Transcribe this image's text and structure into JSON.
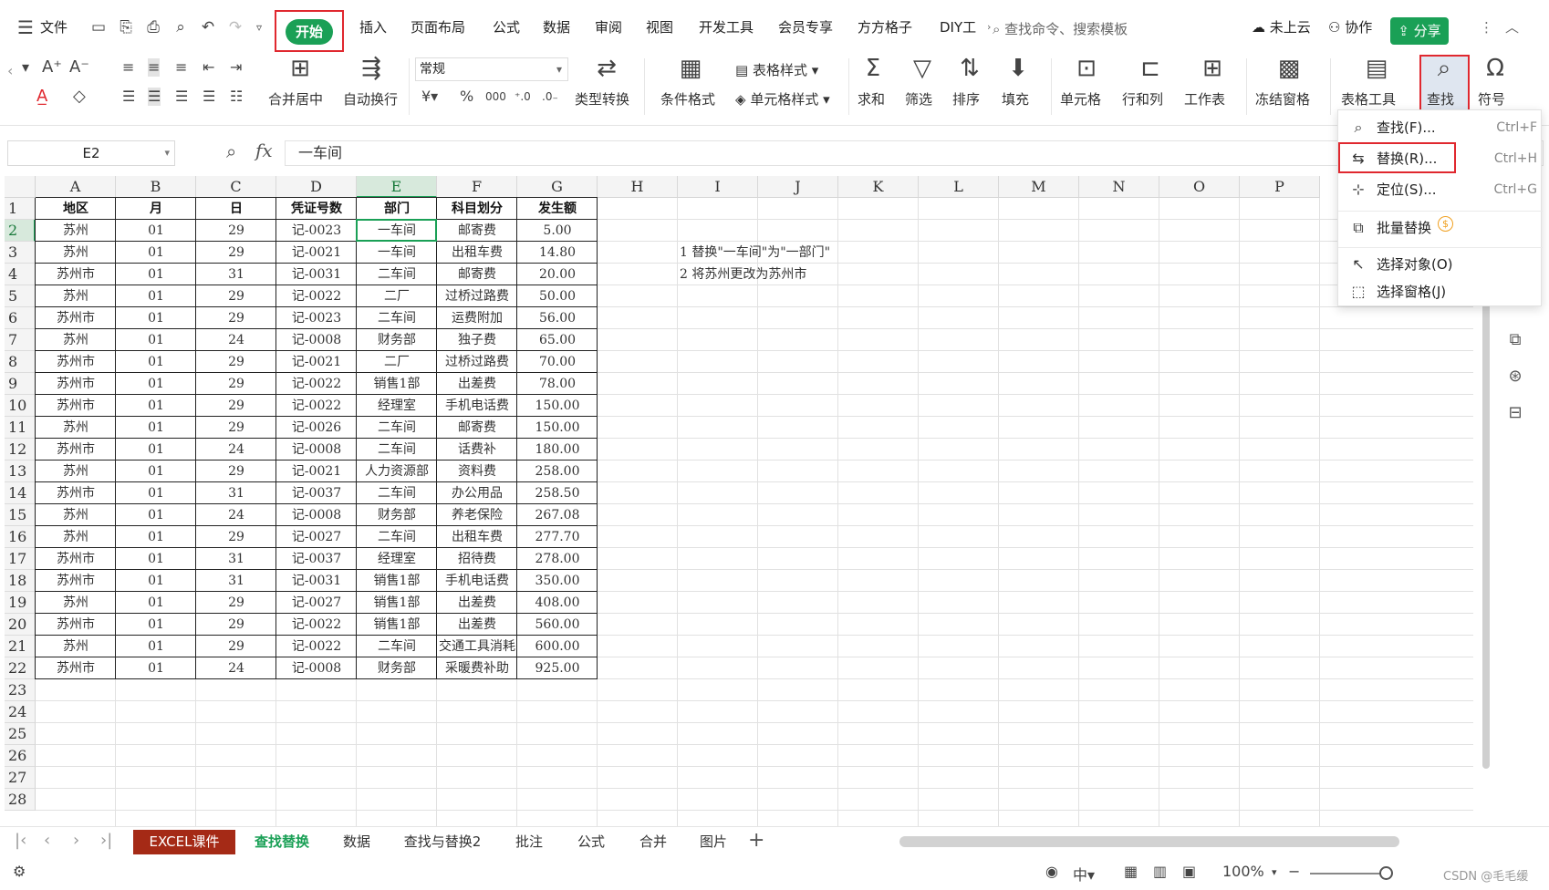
{
  "menubar": {
    "file": "文件",
    "tabs": [
      "开始",
      "插入",
      "页面布局",
      "公式",
      "数据",
      "审阅",
      "视图",
      "开发工具",
      "会员专享",
      "方方格子",
      "DIY工"
    ],
    "search_placeholder": "查找命令、搜索模板",
    "cloud": "未上云",
    "collab": "协作",
    "share": "分享"
  },
  "ribbon": {
    "merge_center": "合并居中",
    "wrap_text": "自动换行",
    "number_format": "常规",
    "type_convert": "类型转换",
    "cond_format": "条件格式",
    "table_style": "表格样式",
    "cell_style": "单元格样式",
    "sum": "求和",
    "filter": "筛选",
    "sort": "排序",
    "fill": "填充",
    "cell": "单元格",
    "row_col": "行和列",
    "worksheet": "工作表",
    "freeze": "冻结窗格",
    "table_tools": "表格工具",
    "find": "查找",
    "symbol": "符号"
  },
  "formula_bar": {
    "name_box": "E2",
    "fx": "fx",
    "content": "一车间"
  },
  "columns": [
    "A",
    "B",
    "C",
    "D",
    "E",
    "F",
    "G",
    "H",
    "I",
    "J",
    "K",
    "L",
    "M",
    "N",
    "O",
    "P"
  ],
  "rows": [
    "1",
    "2",
    "3",
    "4",
    "5",
    "6",
    "7",
    "8",
    "9",
    "10",
    "11",
    "12",
    "13",
    "14",
    "15",
    "16",
    "17",
    "18",
    "19",
    "20",
    "21",
    "22",
    "23",
    "24",
    "25",
    "26",
    "27",
    "28"
  ],
  "table": {
    "header": [
      "地区",
      "月",
      "日",
      "凭证号数",
      "部门",
      "科目划分",
      "发生额"
    ],
    "body": [
      [
        "苏州",
        "01",
        "29",
        "记-0023",
        "一车间",
        "邮寄费",
        "5.00"
      ],
      [
        "苏州",
        "01",
        "29",
        "记-0021",
        "一车间",
        "出租车费",
        "14.80"
      ],
      [
        "苏州市",
        "01",
        "31",
        "记-0031",
        "二车间",
        "邮寄费",
        "20.00"
      ],
      [
        "苏州",
        "01",
        "29",
        "记-0022",
        "二厂",
        "过桥过路费",
        "50.00"
      ],
      [
        "苏州市",
        "01",
        "29",
        "记-0023",
        "二车间",
        "运费附加",
        "56.00"
      ],
      [
        "苏州",
        "01",
        "24",
        "记-0008",
        "财务部",
        "独子费",
        "65.00"
      ],
      [
        "苏州市",
        "01",
        "29",
        "记-0021",
        "二厂",
        "过桥过路费",
        "70.00"
      ],
      [
        "苏州市",
        "01",
        "29",
        "记-0022",
        "销售1部",
        "出差费",
        "78.00"
      ],
      [
        "苏州市",
        "01",
        "29",
        "记-0022",
        "经理室",
        "手机电话费",
        "150.00"
      ],
      [
        "苏州",
        "01",
        "29",
        "记-0026",
        "二车间",
        "邮寄费",
        "150.00"
      ],
      [
        "苏州市",
        "01",
        "24",
        "记-0008",
        "二车间",
        "话费补",
        "180.00"
      ],
      [
        "苏州",
        "01",
        "29",
        "记-0021",
        "人力资源部",
        "资料费",
        "258.00"
      ],
      [
        "苏州市",
        "01",
        "31",
        "记-0037",
        "二车间",
        "办公用品",
        "258.50"
      ],
      [
        "苏州",
        "01",
        "24",
        "记-0008",
        "财务部",
        "养老保险",
        "267.08"
      ],
      [
        "苏州",
        "01",
        "29",
        "记-0027",
        "二车间",
        "出租车费",
        "277.70"
      ],
      [
        "苏州市",
        "01",
        "31",
        "记-0037",
        "经理室",
        "招待费",
        "278.00"
      ],
      [
        "苏州市",
        "01",
        "31",
        "记-0031",
        "销售1部",
        "手机电话费",
        "350.00"
      ],
      [
        "苏州",
        "01",
        "29",
        "记-0027",
        "销售1部",
        "出差费",
        "408.00"
      ],
      [
        "苏州市",
        "01",
        "29",
        "记-0022",
        "销售1部",
        "出差费",
        "560.00"
      ],
      [
        "苏州",
        "01",
        "29",
        "记-0022",
        "二车间",
        "交通工具消耗",
        "600.00"
      ],
      [
        "苏州市",
        "01",
        "24",
        "记-0008",
        "财务部",
        "采暖费补助",
        "925.00"
      ]
    ]
  },
  "notes": [
    "1 替换\"一车间\"为\"一部门\"",
    "2 将苏州更改为苏州市"
  ],
  "find_menu": [
    {
      "label": "查找(F)...",
      "shortcut": "Ctrl+F"
    },
    {
      "label": "替换(R)...",
      "shortcut": "Ctrl+H"
    },
    {
      "label": "定位(S)...",
      "shortcut": "Ctrl+G"
    },
    {
      "label": "批量替换",
      "shortcut": ""
    },
    {
      "label": "选择对象(O)",
      "shortcut": ""
    },
    {
      "label": "选择窗格(J)",
      "shortcut": ""
    }
  ],
  "sheet_tabs": [
    "EXCEL课件",
    "查找替换",
    "数据",
    "查找与替换2",
    "批注",
    "公式",
    "合并",
    "图片"
  ],
  "status": {
    "zoom": "100%"
  },
  "watermark": "CSDN @毛毛缓"
}
